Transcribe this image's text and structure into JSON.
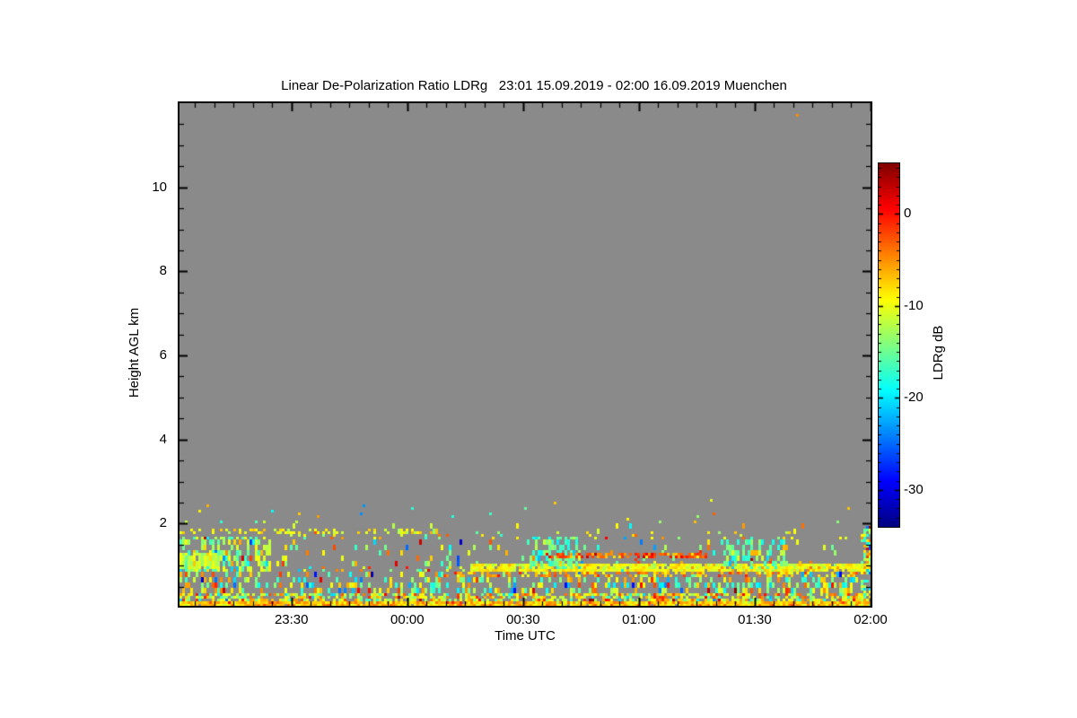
{
  "figure": {
    "background": "#ffffff"
  },
  "chart_data": {
    "type": "heatmap",
    "title": "Linear De-Polarization Ratio LDRg   23:01 15.09.2019 - 02:00 16.09.2019 Muenchen",
    "station": "Muenchen",
    "time_start": "23:01 15.09.2019",
    "time_end": "02:00 16.09.2019",
    "xlabel": "Time UTC",
    "ylabel": "Height AGL km",
    "colorbar_label": "LDRg dB",
    "x_duration_min": 179,
    "x_ticks": [
      {
        "label": "23:30",
        "t_min": 29
      },
      {
        "label": "00:00",
        "t_min": 59
      },
      {
        "label": "00:30",
        "t_min": 89
      },
      {
        "label": "01:00",
        "t_min": 119
      },
      {
        "label": "01:30",
        "t_min": 149
      },
      {
        "label": "02:00",
        "t_min": 179
      }
    ],
    "x_minor_tick_step_min": 5,
    "y_range_km": [
      0,
      12
    ],
    "y_ticks": [
      {
        "label": "2",
        "km": 2
      },
      {
        "label": "4",
        "km": 4
      },
      {
        "label": "6",
        "km": 6
      },
      {
        "label": "8",
        "km": 8
      },
      {
        "label": "10",
        "km": 10
      }
    ],
    "y_minor_tick_step_km": 0.5,
    "value_range_db": [
      -34,
      5.5
    ],
    "colorbar_ticks": [
      {
        "label": "0",
        "db": 0
      },
      {
        "label": "-10",
        "db": -10
      },
      {
        "label": "-20",
        "db": -20
      },
      {
        "label": "-30",
        "db": -30
      }
    ],
    "colorbar_minor_tick_step_db": 1,
    "colormap": "jet",
    "colormap_stops": [
      {
        "pos": 0.0,
        "color": "#000080"
      },
      {
        "pos": 0.125,
        "color": "#0000ff"
      },
      {
        "pos": 0.375,
        "color": "#00ffff"
      },
      {
        "pos": 0.625,
        "color": "#ffff00"
      },
      {
        "pos": 0.875,
        "color": "#ff0000"
      },
      {
        "pos": 1.0,
        "color": "#800000"
      }
    ],
    "no_data_color": "#8a8a8a",
    "frame_color": "#000000",
    "description": "Grey = no signal. Depolarization returns confined below ~2.2 km AGL: near-continuous surface echo, speckled boundary-layer returns, thin layers near 0.9 km and 1.8 km, denser patches around 23:01-23:25, 00:30-00:45 and 01:20-01:40.",
    "signal_regions": [
      {
        "name": "ground-echo-line",
        "t": [
          0,
          179
        ],
        "h": [
          0.0,
          0.16
        ],
        "coverage": 0.98,
        "ldr_mean_db": -7,
        "ldr_std_db": 2.5,
        "clump": false
      },
      {
        "name": "surface-band",
        "t": [
          0,
          179
        ],
        "h": [
          0.16,
          0.36
        ],
        "coverage": 0.62,
        "ldr_mean_db": -10,
        "ldr_std_db": 5,
        "clump": false
      },
      {
        "name": "near-surface-mix",
        "t": [
          0,
          179
        ],
        "h": [
          0.36,
          0.7
        ],
        "coverage": 0.38,
        "ldr_mean_db": -13,
        "ldr_std_db": 6.5,
        "clump": true
      },
      {
        "name": "boundary-sparse",
        "t": [
          0,
          179
        ],
        "h": [
          0.7,
          0.95
        ],
        "coverage": 0.2,
        "ldr_mean_db": -12.5,
        "ldr_std_db": 6,
        "clump": true
      },
      {
        "name": "speckle-1.0-1.7km",
        "t": [
          0,
          179
        ],
        "h": [
          0.95,
          1.7
        ],
        "coverage": 0.1,
        "ldr_mean_db": -12,
        "ldr_std_db": 6.5,
        "clump": true
      },
      {
        "name": "sparse-1.7-2.1km",
        "t": [
          0,
          179
        ],
        "h": [
          1.7,
          2.1
        ],
        "coverage": 0.045,
        "ldr_mean_db": -11,
        "ldr_std_db": 5,
        "clump": true
      },
      {
        "name": "very-sparse-2.1-2.6km",
        "t": [
          0,
          179
        ],
        "h": [
          2.1,
          2.6
        ],
        "coverage": 0.01,
        "ldr_mean_db": -10,
        "ldr_std_db": 7,
        "clump": false
      },
      {
        "name": "isolated-dots-above",
        "t": [
          0,
          179
        ],
        "h": [
          2.6,
          11.9
        ],
        "coverage": 6e-05,
        "ldr_mean_db": -8,
        "ldr_std_db": 8,
        "clump": false
      },
      {
        "name": "left-cloud-patch",
        "t": [
          0,
          24
        ],
        "h": [
          0.85,
          1.7
        ],
        "coverage": 0.5,
        "ldr_mean_db": -13.5,
        "ldr_std_db": 3.5,
        "clump": true
      },
      {
        "name": "left-bright-blob",
        "t": [
          0,
          10
        ],
        "h": [
          0.95,
          1.3
        ],
        "coverage": 0.72,
        "ldr_mean_db": -11,
        "ldr_std_db": 1.5,
        "clump": true
      },
      {
        "name": "broken-layer-1.8km-left",
        "t": [
          0,
          62
        ],
        "h": [
          1.72,
          1.86
        ],
        "coverage": 0.3,
        "ldr_mean_db": -9.5,
        "ldr_std_db": 1.5,
        "clump": false
      },
      {
        "name": "thin-layer-1.8km-right",
        "t": [
          62,
          179
        ],
        "h": [
          1.72,
          1.84
        ],
        "coverage": 0.09,
        "ldr_mean_db": -9.5,
        "ldr_std_db": 2.5,
        "clump": false
      },
      {
        "name": "strong-layer-0.9km",
        "t": [
          75,
          179
        ],
        "h": [
          0.86,
          1.02
        ],
        "coverage": 0.93,
        "ldr_mean_db": -9.5,
        "ldr_std_db": 1.8,
        "clump": false
      },
      {
        "name": "layer-fringe",
        "t": [
          68,
          179
        ],
        "h": [
          0.74,
          0.86
        ],
        "coverage": 0.42,
        "ldr_mean_db": -6.5,
        "ldr_std_db": 3,
        "clump": false
      },
      {
        "name": "green-patch-a",
        "t": [
          90,
          104
        ],
        "h": [
          0.95,
          1.7
        ],
        "coverage": 0.48,
        "ldr_mean_db": -15.5,
        "ldr_std_db": 2.5,
        "clump": true
      },
      {
        "name": "green-patch-b",
        "t": [
          140,
          158
        ],
        "h": [
          0.95,
          1.6
        ],
        "coverage": 0.42,
        "ldr_mean_db": -15.5,
        "ldr_std_db": 2.5,
        "clump": true
      },
      {
        "name": "red-streaks-mid",
        "t": [
          95,
          137
        ],
        "h": [
          1.02,
          1.3
        ],
        "coverage": 0.26,
        "ldr_mean_db": -3,
        "ldr_std_db": 3,
        "streak_rows": true
      },
      {
        "name": "red-streaks-right",
        "t": [
          148,
          172
        ],
        "h": [
          1.02,
          1.25
        ],
        "coverage": 0.22,
        "ldr_mean_db": -4,
        "ldr_std_db": 3,
        "streak_rows": true
      },
      {
        "name": "right-edge-column",
        "t": [
          176.5,
          179
        ],
        "h": [
          0.0,
          1.95
        ],
        "coverage": 0.48,
        "ldr_mean_db": -13,
        "ldr_std_db": 6.5,
        "clump": false
      }
    ]
  }
}
